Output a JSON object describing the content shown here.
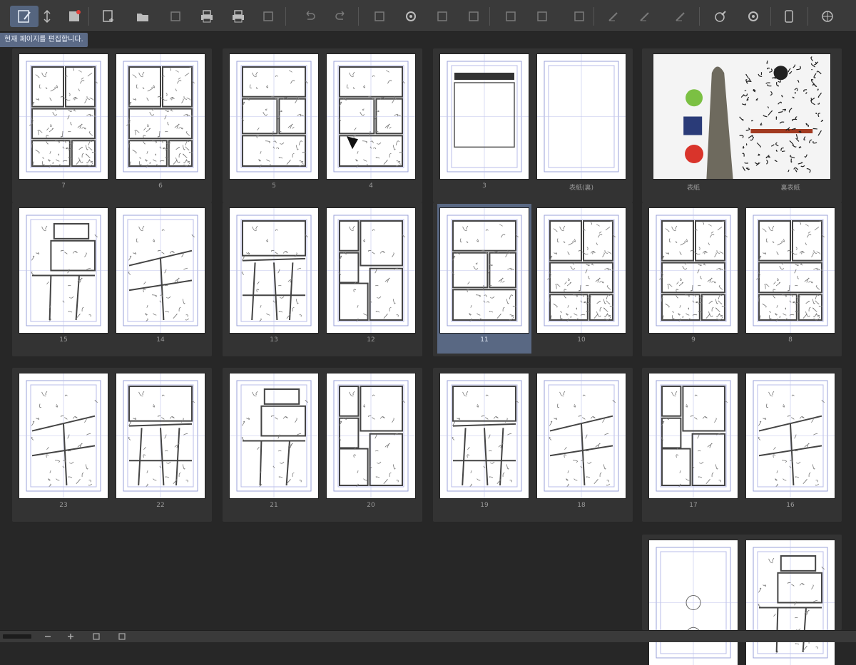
{
  "tooltip": "현재 페이지를 편집합니다.",
  "toolbar": {
    "buttons": [
      {
        "icon": "edit-page-icon",
        "active": true
      },
      {
        "icon": "swap-icon",
        "active": false
      },
      {
        "icon": "save-icon",
        "active": false
      },
      {
        "icon": "add-page-icon",
        "active": false
      },
      {
        "icon": "open-folder-icon",
        "active": false
      },
      {
        "icon": "export-icon",
        "active": false
      },
      {
        "icon": "print-icon",
        "active": false
      },
      {
        "icon": "print-settings-icon",
        "active": false
      },
      {
        "icon": "layer-icon",
        "active": false
      },
      {
        "icon": "undo-icon",
        "active": false
      },
      {
        "icon": "redo-icon",
        "active": false
      },
      {
        "icon": "shape-icon",
        "active": false
      },
      {
        "icon": "settings-icon",
        "active": false
      },
      {
        "icon": "palette-icon",
        "active": false
      },
      {
        "icon": "clipboard-icon",
        "active": false
      },
      {
        "icon": "crop-icon",
        "active": false
      },
      {
        "icon": "scale-icon",
        "active": false
      },
      {
        "icon": "square-icon",
        "active": false
      },
      {
        "icon": "pen-icon",
        "active": false
      },
      {
        "icon": "pencil-icon",
        "active": false
      },
      {
        "icon": "brush-icon",
        "active": false
      },
      {
        "icon": "gradient-icon",
        "active": false
      },
      {
        "icon": "sync-icon",
        "active": false
      },
      {
        "icon": "device-icon",
        "active": false
      },
      {
        "icon": "web-icon",
        "active": false
      }
    ]
  },
  "spreads": [
    {
      "pages": [
        {
          "label": "7",
          "art": "dense"
        },
        {
          "label": "6",
          "art": "dense"
        }
      ]
    },
    {
      "pages": [
        {
          "label": "5",
          "art": "panels"
        },
        {
          "label": "4",
          "art": "panels-dark"
        }
      ]
    },
    {
      "pages": [
        {
          "label": "3",
          "art": "text-box"
        },
        {
          "label": "表紙(裏)",
          "art": "empty"
        }
      ]
    },
    {
      "pages": [
        {
          "label": "表紙",
          "art": "cover"
        }
      ],
      "label_right": "裏表紙",
      "wide": true
    },
    {
      "pages": [
        {
          "label": "15",
          "art": "sketch"
        },
        {
          "label": "14",
          "art": "slant"
        }
      ]
    },
    {
      "pages": [
        {
          "label": "13",
          "art": "sketch2"
        },
        {
          "label": "12",
          "art": "grid"
        }
      ]
    },
    {
      "pages": [
        {
          "label": "11",
          "art": "panels",
          "selected": true
        },
        {
          "label": "10",
          "art": "dense"
        }
      ]
    },
    {
      "pages": [
        {
          "label": "9",
          "art": "dense"
        },
        {
          "label": "8",
          "art": "dense"
        }
      ]
    },
    {
      "pages": [
        {
          "label": "23",
          "art": "slant"
        },
        {
          "label": "22",
          "art": "sketch2"
        }
      ]
    },
    {
      "pages": [
        {
          "label": "21",
          "art": "sketch"
        },
        {
          "label": "20",
          "art": "grid"
        }
      ]
    },
    {
      "pages": [
        {
          "label": "19",
          "art": "sketch2"
        },
        {
          "label": "18",
          "art": "slant"
        }
      ]
    },
    {
      "pages": [
        {
          "label": "17",
          "art": "grid"
        },
        {
          "label": "16",
          "art": "slant"
        }
      ]
    },
    {
      "pages": [
        {
          "label": "",
          "art": "figure"
        },
        {
          "label": "",
          "art": "sketch"
        }
      ],
      "half": true
    }
  ],
  "statusbar": {
    "buttons": [
      "zoom-out-icon",
      "zoom-in-icon",
      "fit-page-icon",
      "fit-width-icon"
    ]
  }
}
